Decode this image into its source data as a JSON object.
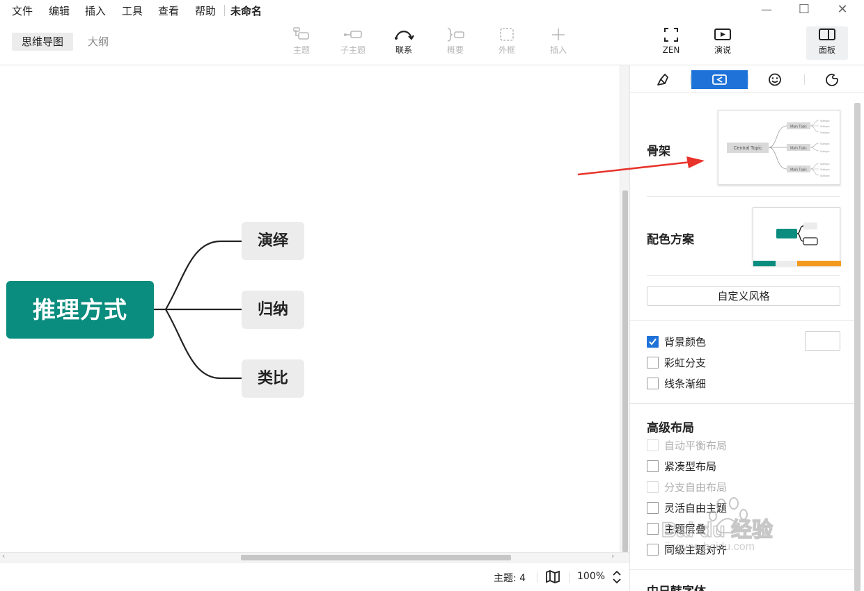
{
  "menu": {
    "file": "文件",
    "edit": "编辑",
    "insert": "插入",
    "tools": "工具",
    "view": "查看",
    "help": "帮助"
  },
  "document": {
    "title": "未命名"
  },
  "window": {
    "minimize": "—",
    "maximize": "☐",
    "close": "✕"
  },
  "view_tabs": {
    "mindmap": "思维导图",
    "outline": "大纲"
  },
  "toolbar": {
    "topic": "主题",
    "subtopic": "子主题",
    "relationship": "联系",
    "summary": "概要",
    "boundary": "外框",
    "insert": "插入",
    "zen": "ZEN",
    "pitch": "演说",
    "panel": "面板"
  },
  "map": {
    "central": "推理方式",
    "topics": [
      "演绎",
      "归纳",
      "类比"
    ]
  },
  "status": {
    "topic_count": "主题: 4",
    "zoom": "100%"
  },
  "panel": {
    "skeleton_label": "骨架",
    "color_scheme_label": "配色方案",
    "custom_style_button": "自定义风格",
    "skeleton_preview": {
      "central": "Central Topic",
      "main": "Main Topic",
      "sub": "Subtopic"
    },
    "options": [
      {
        "label": "背景颜色",
        "checked": true
      },
      {
        "label": "彩虹分支",
        "checked": false
      },
      {
        "label": "线条渐细",
        "checked": false
      }
    ],
    "advanced_layout_label": "高级布局",
    "advanced": [
      {
        "label": "自动平衡布局",
        "disabled": true
      },
      {
        "label": "紧凑型布局",
        "disabled": false
      },
      {
        "label": "分支自由布局",
        "disabled": true
      },
      {
        "label": "灵活自由主题",
        "disabled": false
      },
      {
        "label": "主题层叠",
        "disabled": false
      },
      {
        "label": "同级主题对齐",
        "disabled": false
      }
    ],
    "next_section_label": "中日韩字体"
  },
  "colors": {
    "brand_teal": "#0a8d7e",
    "accent_blue": "#1f73d8",
    "annotation_arrow": "#e8332a",
    "orange": "#f39a1e"
  },
  "watermark": {
    "logo": "Bai du 经验",
    "url": "jingyan.baidu.com"
  }
}
